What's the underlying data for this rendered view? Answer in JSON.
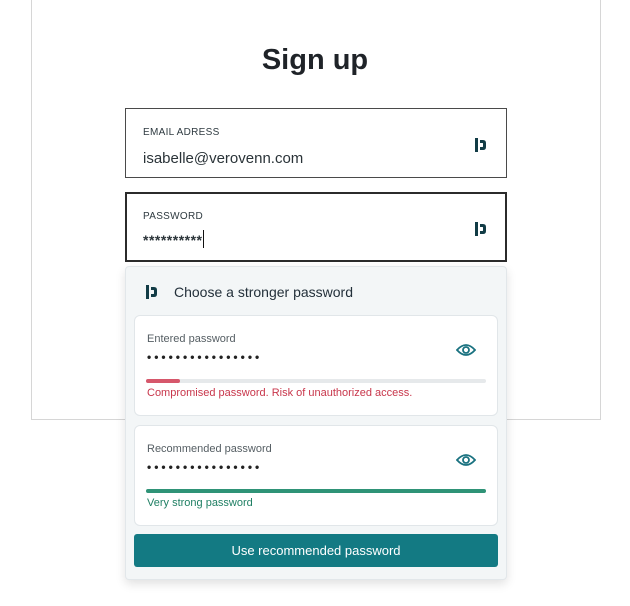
{
  "page": {
    "title": "Sign up"
  },
  "email_field": {
    "label": "EMAIL ADRESS",
    "value": "isabelle@verovenn.com",
    "icon": "dashlane-logo-icon"
  },
  "password_field": {
    "label": "PASSWORD",
    "value": "**********",
    "icon": "dashlane-logo-icon"
  },
  "suggestion": {
    "header_icon": "dashlane-logo-icon",
    "title": "Choose a stronger password",
    "entered": {
      "label": "Entered password",
      "masked": "••••••••••••••••",
      "strength_fraction": 0.1,
      "strength_color": "#d6576b",
      "message": "Compromised password. Risk of unauthorized access.",
      "icon": "eye-icon"
    },
    "recommended": {
      "label": "Recommended password",
      "masked": "••••••••••••••••",
      "strength_fraction": 1.0,
      "strength_color": "#2f9377",
      "message": "Very strong password",
      "icon": "eye-icon"
    },
    "button_label": "Use recommended password",
    "button_color": "#137a83"
  }
}
